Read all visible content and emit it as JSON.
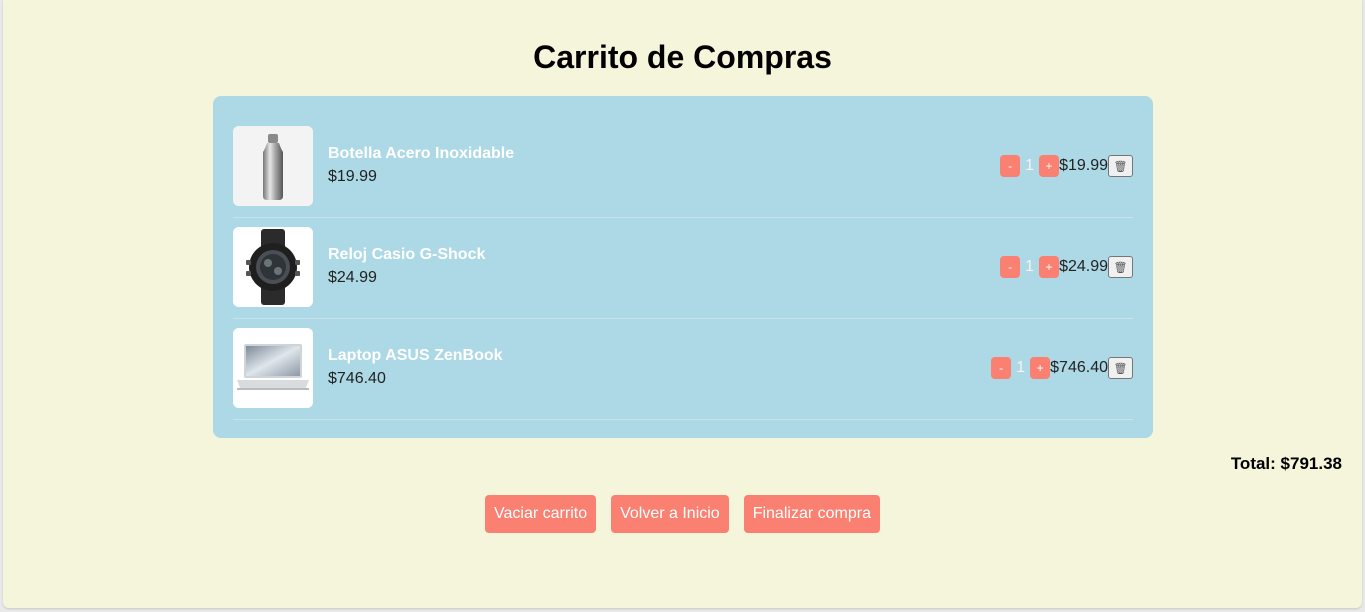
{
  "header": {
    "title": "Carrito de Compras"
  },
  "cart": {
    "items": [
      {
        "name": "Botella Acero Inoxidable",
        "price": "$19.99",
        "quantity": "1",
        "subtotal": "$19.99",
        "minus": "-",
        "plus": "+",
        "delete_icon": "🗑"
      },
      {
        "name": "Reloj Casio G-Shock",
        "price": "$24.99",
        "quantity": "1",
        "subtotal": "$24.99",
        "minus": "-",
        "plus": "+",
        "delete_icon": "🗑"
      },
      {
        "name": "Laptop ASUS ZenBook",
        "price": "$746.40",
        "quantity": "1",
        "subtotal": "$746.40",
        "minus": "-",
        "plus": "+",
        "delete_icon": "🗑"
      }
    ],
    "total": "Total: $791.38"
  },
  "actions": {
    "empty_cart": "Vaciar carrito",
    "back_home": "Volver a Inicio",
    "checkout": "Finalizar compra"
  },
  "colors": {
    "background": "#f5f5dc",
    "cart_panel": "#add8e6",
    "accent": "#fa8072"
  }
}
